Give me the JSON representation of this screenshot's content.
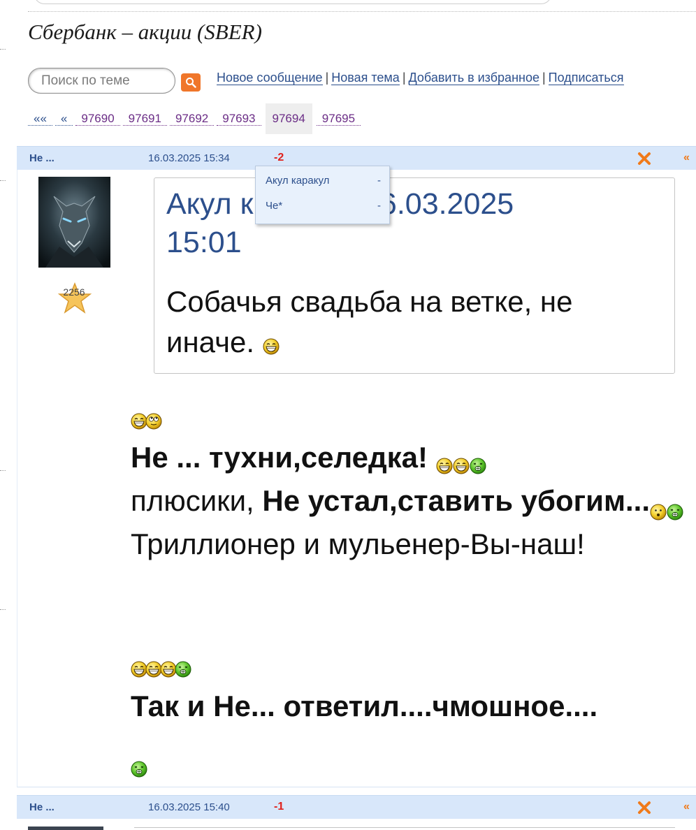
{
  "page": {
    "title": "Сбербанк – акции (SBER)"
  },
  "search": {
    "placeholder": "Поиск по теме",
    "button_icon": "search-icon"
  },
  "actions": {
    "links": [
      "Новое сообщение",
      "Новая тема",
      "Добавить в избранное",
      "Подписаться"
    ]
  },
  "pagination": {
    "first": "««",
    "prev": "«",
    "pages": [
      "97690",
      "97691",
      "97692",
      "97693",
      "97694",
      "97695"
    ],
    "current": "97694"
  },
  "posts": [
    {
      "author": "Не ...",
      "date": "16.03.2025 15:34",
      "rating": "-2",
      "delete_icon": "close-x-icon",
      "quote_link": "«",
      "user_rank": "2256",
      "rating_popup": [
        {
          "name": "Акул каракул",
          "vote": "-"
        },
        {
          "name": "Че*",
          "vote": "-"
        }
      ],
      "quote": {
        "author_prefix": "Акул к",
        "at": "@",
        "date": "16.03.2025",
        "time": "15:01",
        "text": "Собачья свадьба на ветке, не иначе."
      },
      "message": {
        "line1_bold": "Не ... тухни,селедка!",
        "line2_normal": "плюсики, ",
        "line2_bold": "Не устал,ставить убогим...",
        "line3": "Триллионер и мульенер-Вы-наш!",
        "line4_bold": "Так и Не... ответил....чмошное...."
      }
    },
    {
      "author": "Не ...",
      "date": "16.03.2025 15:40",
      "rating": "-1",
      "delete_icon": "close-x-icon",
      "quote_link": "«"
    }
  ],
  "colors": {
    "header_bg": "#d8e7fa",
    "link": "#2c4f8c",
    "visited": "#6b2d86",
    "negative": "#e0201b",
    "accent_orange": "#f0762a"
  }
}
